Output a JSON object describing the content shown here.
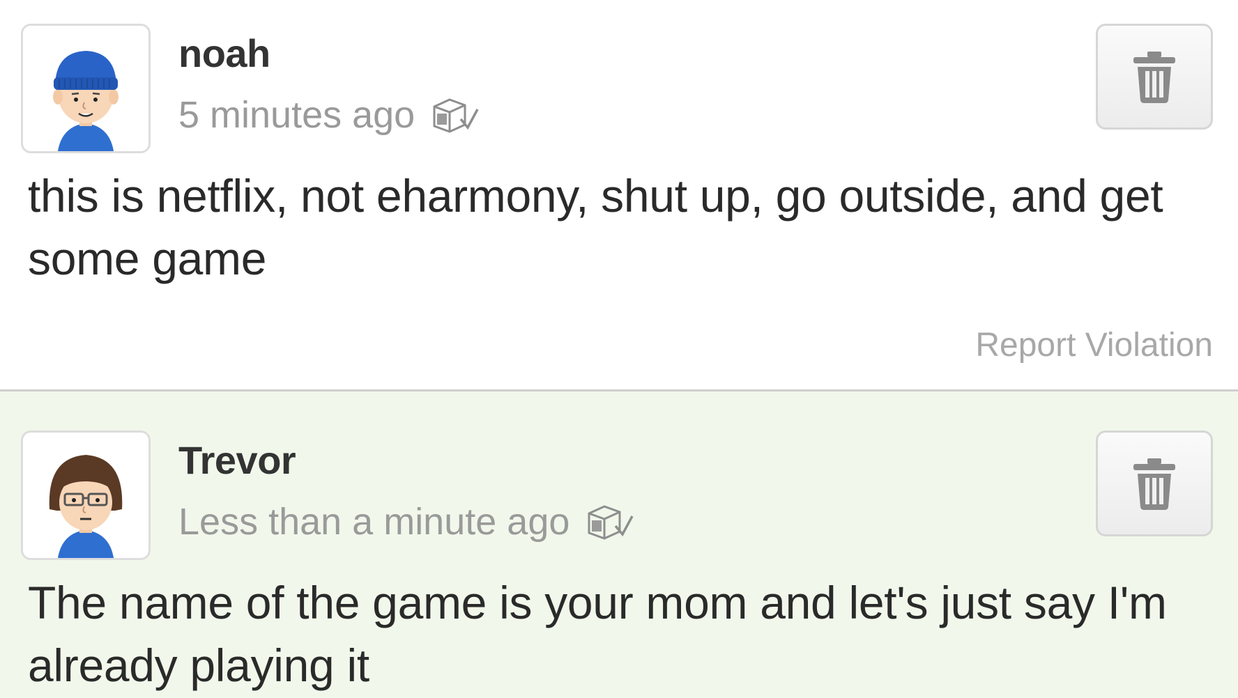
{
  "posts": [
    {
      "username": "noah",
      "timestamp": "5 minutes ago",
      "text": "this is netflix, not eharmony, shut up, go outside, and get some game",
      "report_label": "Report Violation",
      "avatar": "mii-avatar-blue-beanie",
      "status_icon": "spoiler-checked-icon",
      "delete_icon": "trash-icon"
    },
    {
      "username": "Trevor",
      "timestamp": "Less than a minute ago",
      "text": "The name of the game is your mom and let's just say I'm already playing it",
      "avatar": "mii-avatar-brown-hair-glasses",
      "status_icon": "spoiler-checked-icon",
      "delete_icon": "trash-icon"
    }
  ],
  "colors": {
    "reply_background": "#f1f8eb",
    "muted_text": "#9a9a9a",
    "avatar_shirt": "#2f6fd0"
  }
}
